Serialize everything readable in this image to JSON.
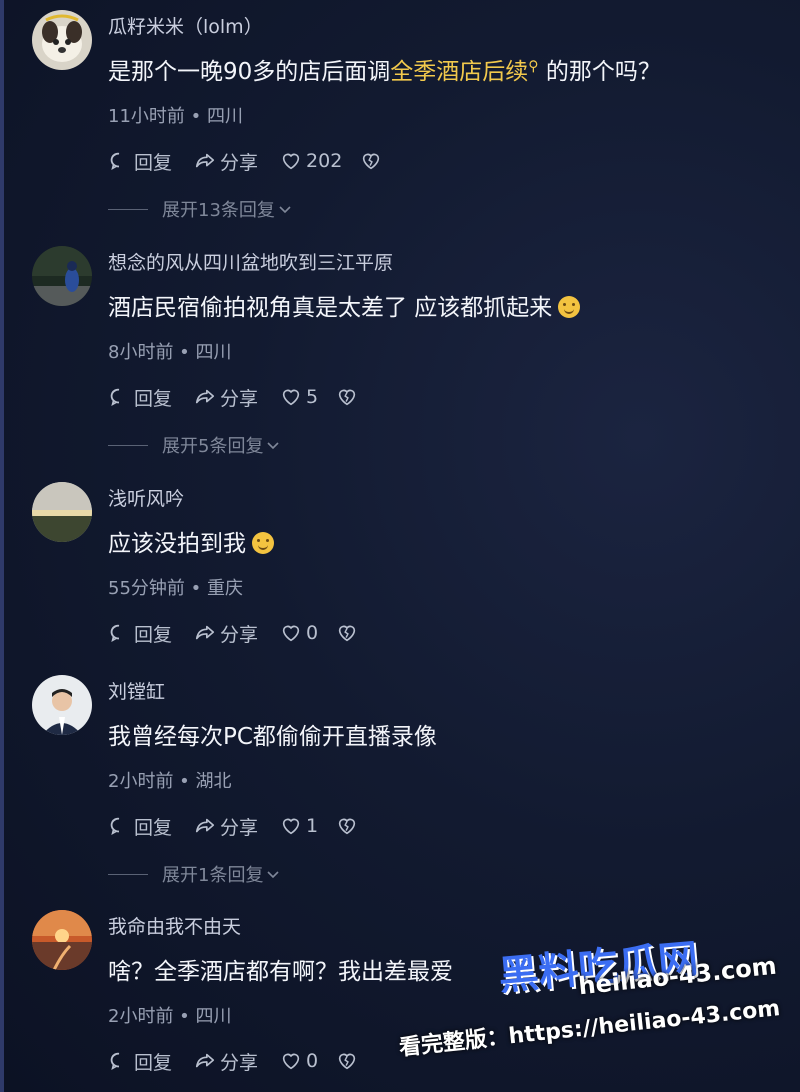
{
  "comments": [
    {
      "username": "瓜籽米米（lolm）",
      "text_before": "是那个一晚90多的店后面调",
      "keyword": "全季酒店后续",
      "keyword_icon": "search-icon",
      "text_after": "的那个吗？",
      "meta": "11小时前 • 四川",
      "reply_label": "回复",
      "share_label": "分享",
      "likes": "202",
      "expand_label": "展开13条回复"
    },
    {
      "username": "想念的风从四川盆地吹到三江平原",
      "text": "酒店民宿偷拍视角真是太差了 应该都抓起来",
      "emoji": "slightly-frowning-emoji",
      "meta": "8小时前 • 四川",
      "reply_label": "回复",
      "share_label": "分享",
      "likes": "5",
      "expand_label": "展开5条回复"
    },
    {
      "username": "浅听风吟",
      "text": "应该没拍到我",
      "emoji": "smiling-emoji",
      "meta": "55分钟前 • 重庆",
      "reply_label": "回复",
      "share_label": "分享",
      "likes": "0"
    },
    {
      "username": "刘镗缸",
      "text": "我曾经每次PC都偷偷开直播录像",
      "meta": "2小时前 • 湖北",
      "reply_label": "回复",
      "share_label": "分享",
      "likes": "1",
      "expand_label": "展开1条回复"
    },
    {
      "username": "我命由我不由天",
      "text": "啥？全季酒店都有啊？我出差最爱",
      "meta": "2小时前 • 四川",
      "reply_label": "回复",
      "share_label": "分享",
      "likes": "0"
    }
  ],
  "watermark": {
    "brand": "黑料吃瓜网",
    "url": "heiliao-43.com",
    "cta": "看完整版：https://heiliao-43.com"
  },
  "colors": {
    "background": "#121a30",
    "keyword": "#f2c94c",
    "muted": "#98a0b3"
  }
}
